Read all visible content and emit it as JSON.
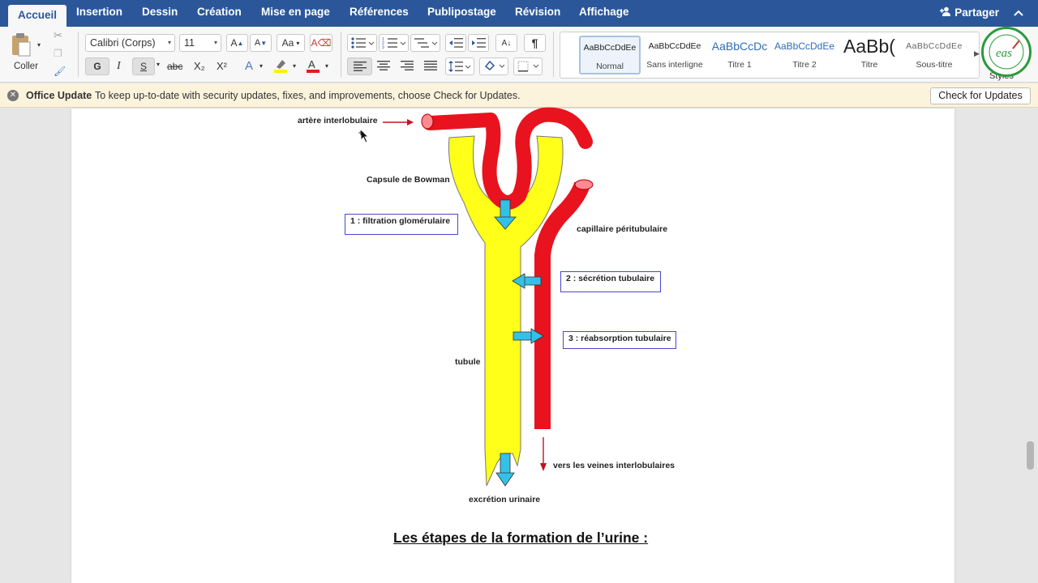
{
  "tabs": [
    {
      "label": "Accueil",
      "active": true
    },
    {
      "label": "Insertion"
    },
    {
      "label": "Dessin"
    },
    {
      "label": "Création"
    },
    {
      "label": "Mise en page"
    },
    {
      "label": "Références"
    },
    {
      "label": "Publipostage"
    },
    {
      "label": "Révision"
    },
    {
      "label": "Affichage"
    }
  ],
  "share_label": "Partager",
  "ribbon": {
    "paste_label": "Coller",
    "font_name": "Calibri (Corps)",
    "font_size": "11",
    "bold": "G",
    "italic": "I",
    "underline": "S",
    "strikethrough": "abc",
    "subscript": "X₂",
    "superscript": "X²",
    "styles": [
      {
        "preview": "AaBbCcDdEe",
        "name": "Normal",
        "selected": true
      },
      {
        "preview": "AaBbCcDdEe",
        "name": "Sans interligne"
      },
      {
        "preview": "AaBbCcDc",
        "name": "Titre 1"
      },
      {
        "preview": "AaBbCcDdEe",
        "name": "Titre 2"
      },
      {
        "preview": "AaBb(",
        "name": "Titre"
      },
      {
        "preview": "AaBbCcDdEe",
        "name": "Sous-titre"
      }
    ],
    "styles_label": "Styles"
  },
  "update_bar": {
    "title": "Office Update",
    "message": "To keep up-to-date with security updates, fixes, and improvements, choose Check for Updates.",
    "button": "Check for Updates"
  },
  "diagram": {
    "labels": {
      "artery": "artère interlobulaire",
      "capsule": "Capsule de Bowman",
      "capillary": "capillaire péritubulaire",
      "tubule": "tubule",
      "veins": "vers les veines interlobulaires",
      "excretion": "excrétion urinaire"
    },
    "steps": [
      "1 : filtration glomérulaire",
      "2 : sécrétion tubulaire",
      "3 : réabsorption tubulaire"
    ]
  },
  "caption": "Les étapes de la formation de l’urine :",
  "colors": {
    "tab_bar": "#2b579a",
    "vessel_red": "#e8131f",
    "tubule_yellow": "#ffff1a",
    "arrow_cyan": "#33c1e8",
    "box_border": "#4a47c9"
  }
}
